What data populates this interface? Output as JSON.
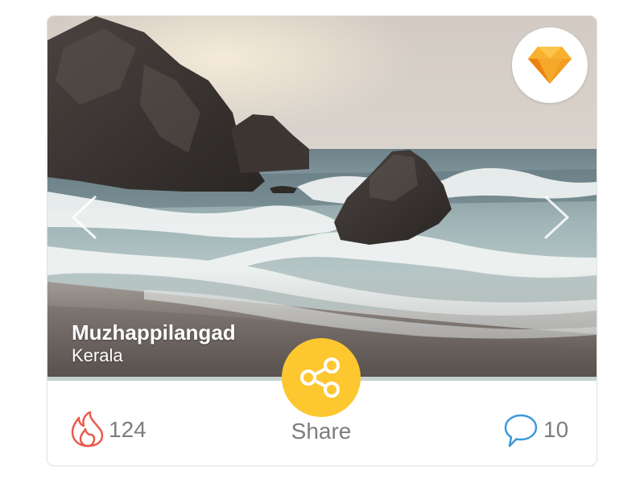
{
  "place": {
    "name": "Muzhappilangad",
    "region": "Kerala"
  },
  "icons": {
    "badge": "sketch-diamond-icon",
    "prev": "chevron-left-icon",
    "next": "chevron-right-icon",
    "share": "share-icon",
    "likes": "flame-icon",
    "comments": "speech-bubble-icon"
  },
  "actions": {
    "share_label": "Share",
    "likes_count": "124",
    "comments_count": "10"
  },
  "colors": {
    "accent": "#fcc72f",
    "flame": "#e85b4b",
    "comment": "#3a9ad9",
    "text": "#7d7d7d"
  }
}
